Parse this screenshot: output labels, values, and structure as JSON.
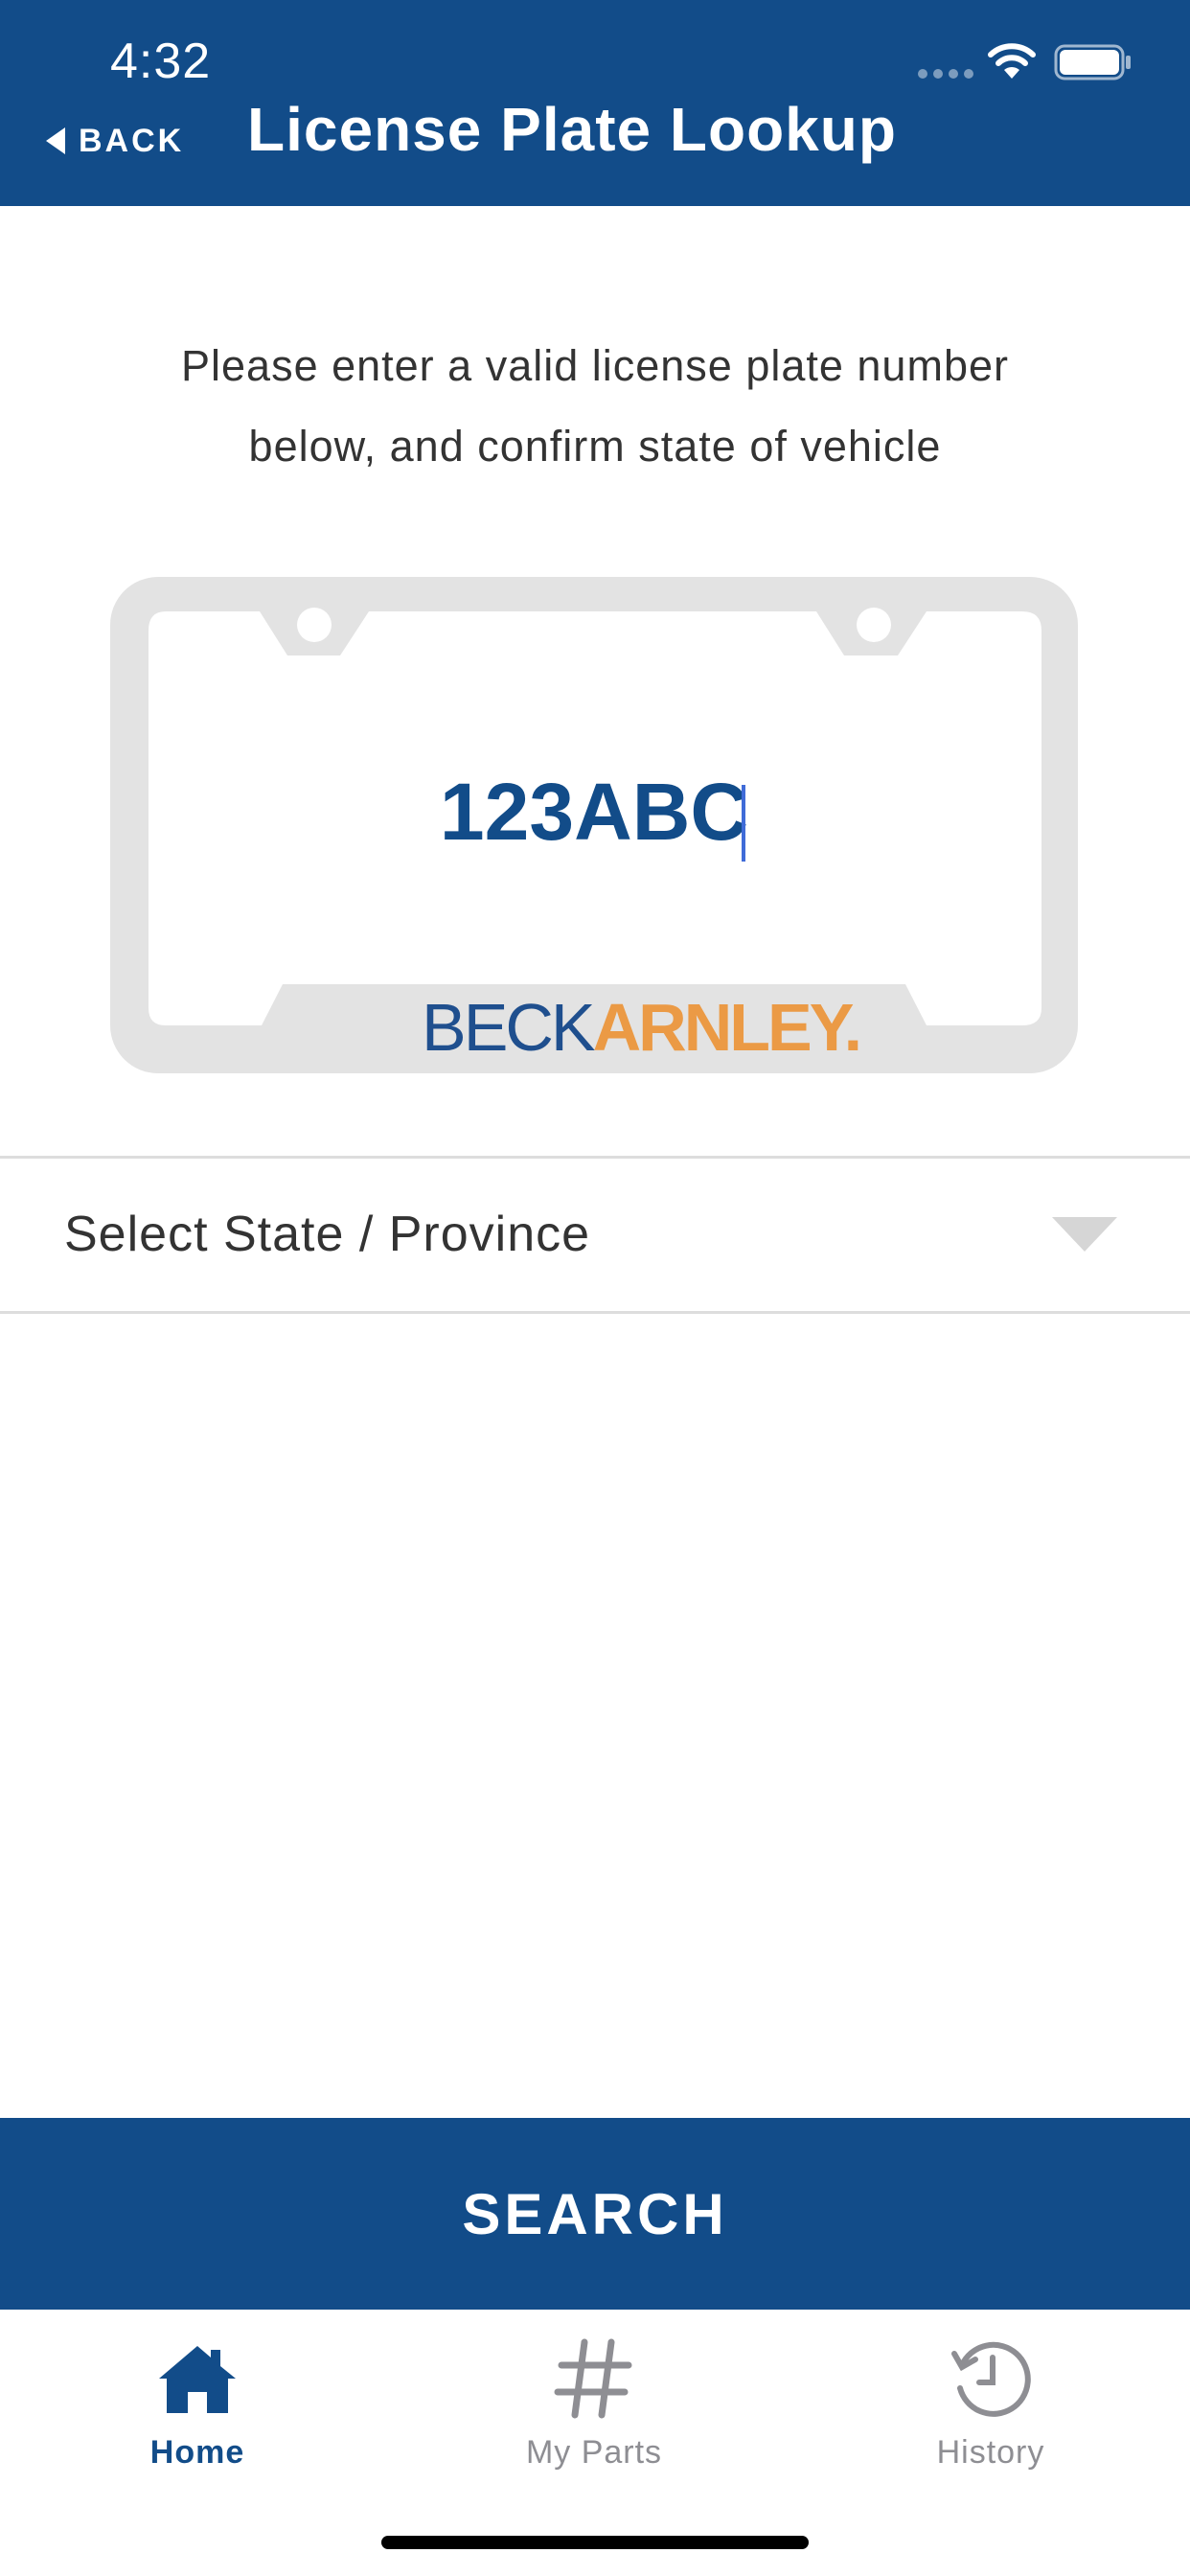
{
  "status_bar": {
    "time": "4:32"
  },
  "header": {
    "back_label": "BACK",
    "title": "License Plate Lookup"
  },
  "instruction": {
    "line1": "Please enter a valid license plate number",
    "line2": "below, and confirm state of vehicle"
  },
  "plate": {
    "value": "123ABC",
    "logo_left": "BECK",
    "logo_right": "ARNLEY."
  },
  "state_select": {
    "placeholder": "Select State / Province"
  },
  "search_button": {
    "label": "SEARCH"
  },
  "tab_bar": {
    "tabs": [
      {
        "label": "Home",
        "icon": "home-icon",
        "active": true
      },
      {
        "label": "My Parts",
        "icon": "hash-icon",
        "active": false
      },
      {
        "label": "History",
        "icon": "history-icon",
        "active": false
      }
    ]
  },
  "colors": {
    "brand_blue": "#124c89",
    "logo_orange": "#eb9a45",
    "inactive_gray": "#8e8e93",
    "plate_frame": "#e3e3e3"
  }
}
